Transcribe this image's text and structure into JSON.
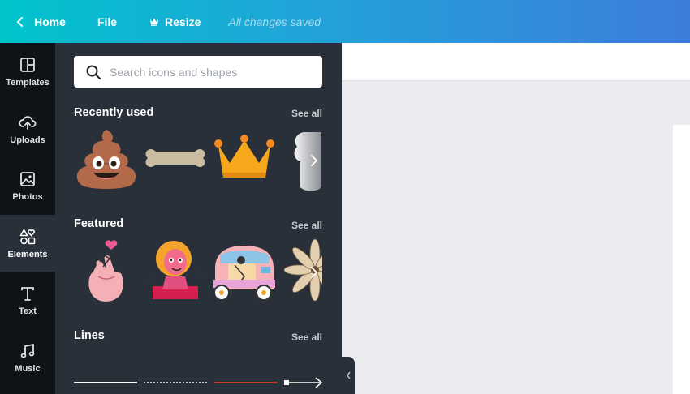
{
  "topbar": {
    "home_label": "Home",
    "file_label": "File",
    "resize_label": "Resize",
    "status": "All changes saved"
  },
  "rail": {
    "items": [
      {
        "label": "Templates",
        "icon": "templates-icon"
      },
      {
        "label": "Uploads",
        "icon": "upload-cloud-icon"
      },
      {
        "label": "Photos",
        "icon": "photo-icon"
      },
      {
        "label": "Elements",
        "icon": "shapes-icon",
        "active": true
      },
      {
        "label": "Text",
        "icon": "text-icon"
      },
      {
        "label": "Music",
        "icon": "music-note-icon"
      }
    ]
  },
  "panel": {
    "search": {
      "placeholder": "Search icons and shapes",
      "value": ""
    },
    "sections": [
      {
        "title": "Recently used",
        "see_all": "See all",
        "items": [
          "poop-emoji",
          "bone",
          "crown",
          "bone-partial"
        ]
      },
      {
        "title": "Featured",
        "see_all": "See all",
        "items": [
          "heart-hand-sticker",
          "girl-illustration",
          "tuk-tuk",
          "flower"
        ]
      },
      {
        "title": "Lines",
        "see_all": "See all",
        "items": [
          "solid-line",
          "dotted-line",
          "red-line",
          "arrow-line"
        ]
      }
    ]
  },
  "colors": {
    "topbar_start": "#00c4cc",
    "topbar_end": "#3d7ddc",
    "rail_bg": "#0e1318",
    "panel_bg": "#293039",
    "canvas_bg": "#ebecf0"
  }
}
